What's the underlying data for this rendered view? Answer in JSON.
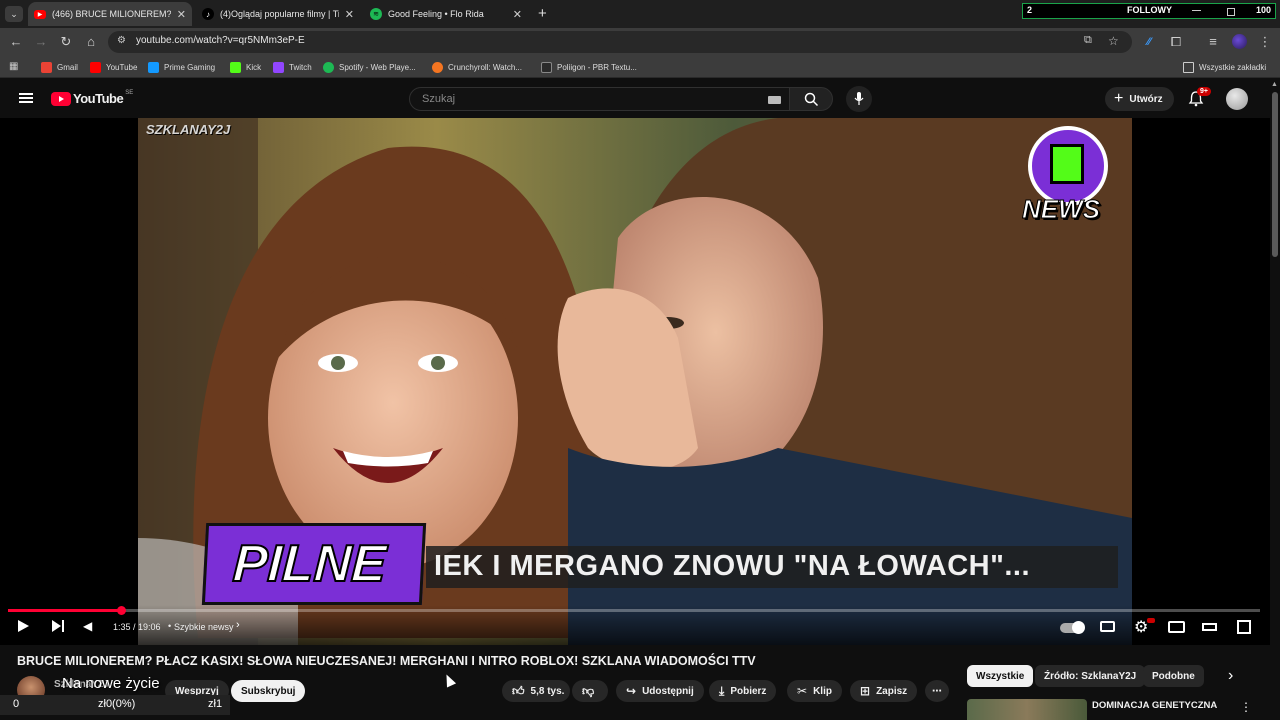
{
  "browser": {
    "tabs": [
      {
        "title": "(466) BRUCE MILIONEREM? PŁ",
        "active": true,
        "favicon": "youtube-icon"
      },
      {
        "title": "(4)Oglądaj popularne filmy | Ti",
        "active": false,
        "favicon": "tiktok-icon"
      },
      {
        "title": "Good Feeling • Flo Rida",
        "active": false,
        "favicon": "spotify-icon"
      }
    ],
    "new_tab": "+",
    "url": "youtube.com/watch?v=qr5NMm3eP-E",
    "bookmarks": [
      {
        "label": "Gmail",
        "color": "#ea4335"
      },
      {
        "label": "YouTube",
        "color": "#ff0000"
      },
      {
        "label": "Prime Gaming",
        "color": "#1399ff"
      },
      {
        "label": "Kick",
        "color": "#53fc18"
      },
      {
        "label": "Twitch",
        "color": "#9146ff"
      },
      {
        "label": "Spotify - Web Playe...",
        "color": "#1db954"
      },
      {
        "label": "Crunchyroll: Watch...",
        "color": "#f47521"
      },
      {
        "label": "Poliigon - PBR Textu...",
        "color": "#2a2a2a"
      }
    ],
    "all_bookmarks": "Wszystkie zakładki"
  },
  "followy": {
    "count": "2",
    "label": "FOLLOWY",
    "goal": "100"
  },
  "youtube": {
    "logo": "YouTube",
    "region": "SE",
    "search_placeholder": "Szukaj",
    "create_label": "Utwórz",
    "notif_badge": "9+"
  },
  "video": {
    "watermark": "SZKLANAY2J",
    "badge": "NEWS",
    "pilne": "PILNE",
    "caption": "IEK I MERGANO ZNOWU \"NA ŁOWACH\"...",
    "progress": 0.09,
    "time": "1:35 / 19:06",
    "chapter": "Szybkie newsy"
  },
  "info": {
    "title": "BRUCE MILIONEREM? PŁACZ KASIX! SŁOWA NIEUCZESANEJ! MERGHANI I NITRO ROBLOX! SZKLANA WIADOMOŚCI TTV",
    "channel": "SzklanaY2J",
    "overlay_text": "Na nowe życie",
    "support": "Wesprzyj",
    "subscribe": "Subskrybuj",
    "likes": "5,8 tys.",
    "share": "Udostępnij",
    "download": "Pobierz",
    "clip": "Klip",
    "save": "Zapisz",
    "donation_bar": {
      "left": "0",
      "middle": "zł0(0%)",
      "right": "zł1"
    }
  },
  "sidebar": {
    "chips": [
      {
        "label": "Wszystkie",
        "active": true
      },
      {
        "label": "Źródło: SzklanaY2J",
        "active": false
      },
      {
        "label": "Podobne",
        "active": false
      }
    ],
    "rec_title": "DOMINACJA GENETYCZNA"
  },
  "colors": {
    "yt_red": "#ff0033",
    "accent_green": "#1aa34a",
    "purple": "#7b2fd6"
  }
}
